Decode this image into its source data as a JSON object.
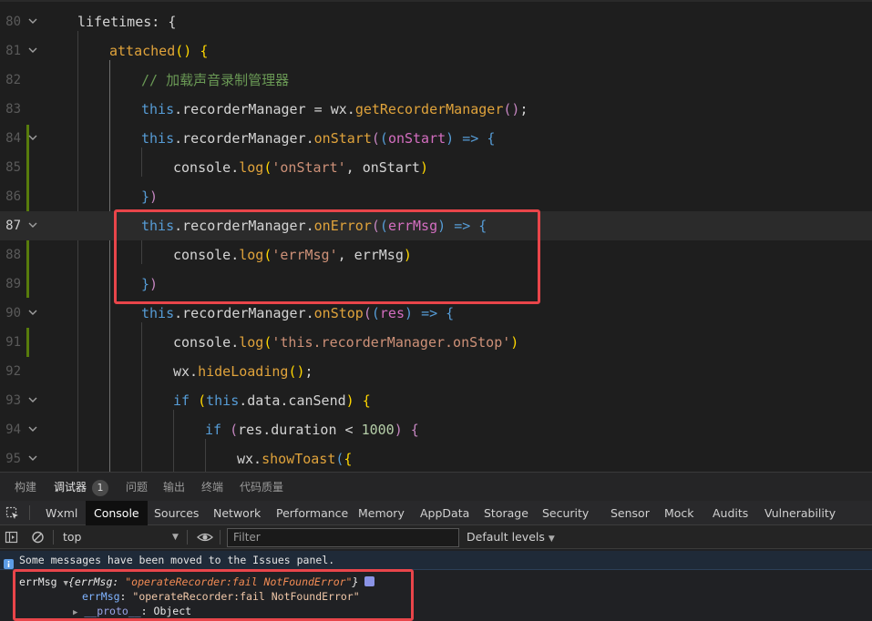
{
  "editor": {
    "lines": [
      {
        "num": "80",
        "text": "lifetimes: {"
      },
      {
        "num": "81",
        "text": "attached() {"
      },
      {
        "num": "82",
        "text": "// 加载声音录制管理器"
      },
      {
        "num": "83",
        "text": "this.recorderManager = wx.getRecorderManager();"
      },
      {
        "num": "84",
        "text": "this.recorderManager.onStart((onStart) => {"
      },
      {
        "num": "85",
        "text": "console.log('onStart', onStart)"
      },
      {
        "num": "86",
        "text": "})"
      },
      {
        "num": "87",
        "text": "this.recorderManager.onError((errMsg) => {"
      },
      {
        "num": "88",
        "text": "console.log('errMsg', errMsg)"
      },
      {
        "num": "89",
        "text": "})"
      },
      {
        "num": "90",
        "text": "this.recorderManager.onStop((res) => {"
      },
      {
        "num": "91",
        "text": "console.log('this.recorderManager.onStop')"
      },
      {
        "num": "92",
        "text": "wx.hideLoading();"
      },
      {
        "num": "93",
        "text": "if (this.data.canSend) {"
      },
      {
        "num": "94",
        "text": "if (res.duration < 1000) {"
      },
      {
        "num": "95",
        "text": "wx.showToast({"
      }
    ]
  },
  "panel_tabs": [
    {
      "label": "构建"
    },
    {
      "label": "调试器",
      "badge": "1"
    },
    {
      "label": "问题"
    },
    {
      "label": "输出"
    },
    {
      "label": "终端"
    },
    {
      "label": "代码质量"
    }
  ],
  "devtools_tabs": [
    "Wxml",
    "Console",
    "Sources",
    "Network",
    "Performance",
    "Memory",
    "AppData",
    "Storage",
    "Security",
    "Sensor",
    "Mock",
    "Audits",
    "Vulnerability"
  ],
  "toolbar": {
    "context": "top",
    "filter_placeholder": "Filter",
    "levels": "Default levels"
  },
  "console": {
    "info_message": "Some messages have been moved to the Issues panel.",
    "log_label": "errMsg",
    "summary_open": "{errMsg: ",
    "summary_value": "\"operateRecorder:fail NotFoundError\"",
    "summary_close": "}",
    "prop_key": "errMsg",
    "prop_value": "\"operateRecorder:fail NotFoundError\"",
    "proto_key": "__proto__",
    "proto_value": "Object"
  },
  "colors": {
    "accent_red": "#e9454a",
    "keyword": "#569cd6",
    "method": "#dcdcaa",
    "string": "#ce9178",
    "comment": "#6a9955"
  }
}
